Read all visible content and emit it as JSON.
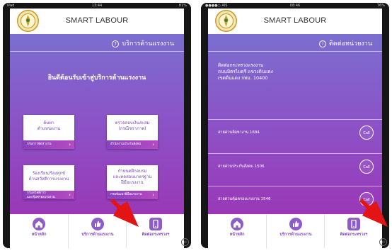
{
  "colors": {
    "purple_top": "#7b6ed0",
    "purple_bottom": "#9a38b8",
    "nav_purple": "#8e5cc9",
    "arrow_red": "#e31414"
  },
  "left": {
    "status": {
      "left": "iPad",
      "time": "13:44",
      "right": "81%"
    },
    "app_title": "SMART LABOUR",
    "section": {
      "icon": "plus-circle-icon",
      "label": "บริการด้านแรงงาน"
    },
    "welcome": "ยินดีต้อนรับเข้าสู่บริการด้านแรงงาน",
    "tiles": [
      {
        "title": "ค้นหา\nตำแหน่งงาน",
        "footer": "กรมการจัดหางาน"
      },
      {
        "title": "ตรวจสอบเงินสะสม\n(กรณีชราภาพ)",
        "footer": "สำนักงานประกันสังคม"
      },
      {
        "title": "ร้องเรียน/ร้องทุกข์\nด้านสวัสดิการแรงงาน",
        "footer": "กรมสวัสดิการ\nและคุ้มครองแรงงาน"
      },
      {
        "title": "กำหนดฝึกอบรม\nและทดสอบมาตรฐาน\nฝีมือแรงงาน",
        "footer": "กรมพัฒนาฝีมือแรงงาน"
      }
    ],
    "nav": [
      {
        "icon": "home-icon",
        "label": "หน้าหลัก"
      },
      {
        "icon": "thumbs-up-icon",
        "label": "บริการด้านแรงงาน"
      },
      {
        "icon": "phone-icon",
        "label": "ติดต่อกระทรวงฯ"
      }
    ],
    "badge": "1X"
  },
  "right": {
    "status": {
      "left": "●●●●○ AIS",
      "time": "08:46",
      "right": "76%"
    },
    "app_title": "SMART LABOUR",
    "section": {
      "icon": "info-circle-icon",
      "label": "ติดต่อหน่วยงาน"
    },
    "contact": {
      "line1": "ติดต่อกระทรวงแรงงาน",
      "line2": "ถนนมิตรไมตรี แขวงดินแดง",
      "line3": "เขตดินแดง กทม. 10400"
    },
    "hotlines": [
      {
        "label": "สายด่วนจัดหางาน 1694",
        "button": "Call"
      },
      {
        "label": "สายด่วนประกันสังคม 1506",
        "button": "Call"
      },
      {
        "label": "สายด่วนคุ้มครองแรงงาน 1546",
        "button": "Call"
      }
    ],
    "nav": [
      {
        "icon": "home-icon",
        "label": "หน้าหลัก"
      },
      {
        "icon": "thumbs-up-icon",
        "label": "บริการด้านแรงงาน"
      },
      {
        "icon": "phone-icon",
        "label": "ติดต่อกระทรวงฯ"
      }
    ],
    "badge": "1X"
  }
}
